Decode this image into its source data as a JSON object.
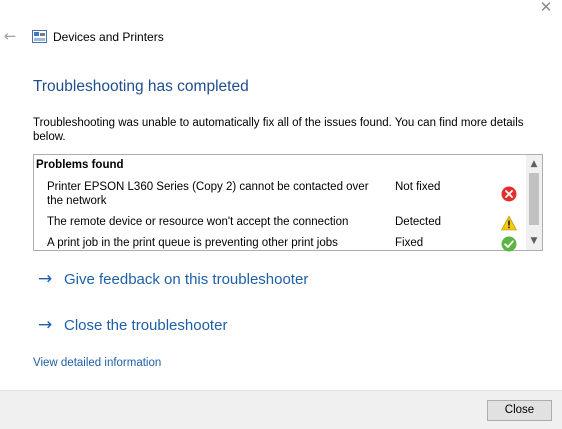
{
  "window": {
    "close_glyph": "✕"
  },
  "header": {
    "back_glyph": "←",
    "app_icon": "devices-and-printers-icon",
    "title": "Devices and Printers"
  },
  "main": {
    "heading": "Troubleshooting has completed",
    "description": "Troubleshooting was unable to automatically fix all of the issues found. You can find more details below."
  },
  "problems": {
    "title": "Problems found",
    "rows": [
      {
        "description": "Printer EPSON L360 Series (Copy 2) cannot be contacted over the network",
        "status": "Not fixed",
        "icon": "error-icon"
      },
      {
        "description": "The remote device or resource won't accept the connection",
        "status": "Detected",
        "icon": "warning-icon"
      },
      {
        "description": "A print job in the print queue is preventing other print jobs",
        "status": "Fixed",
        "icon": "success-icon"
      }
    ],
    "scroll_up_glyph": "▲",
    "scroll_down_glyph": "▼"
  },
  "actions": {
    "arrow_glyph": "→",
    "feedback": "Give feedback on this troubleshooter",
    "close_troubleshooter": "Close the troubleshooter",
    "view_details": "View detailed information"
  },
  "footer": {
    "close_button": "Close"
  },
  "colors": {
    "heading": "#1e4e8c",
    "link": "#1e5fa7",
    "error": "#e0302e",
    "warning": "#f2c811",
    "success": "#5bb543"
  }
}
